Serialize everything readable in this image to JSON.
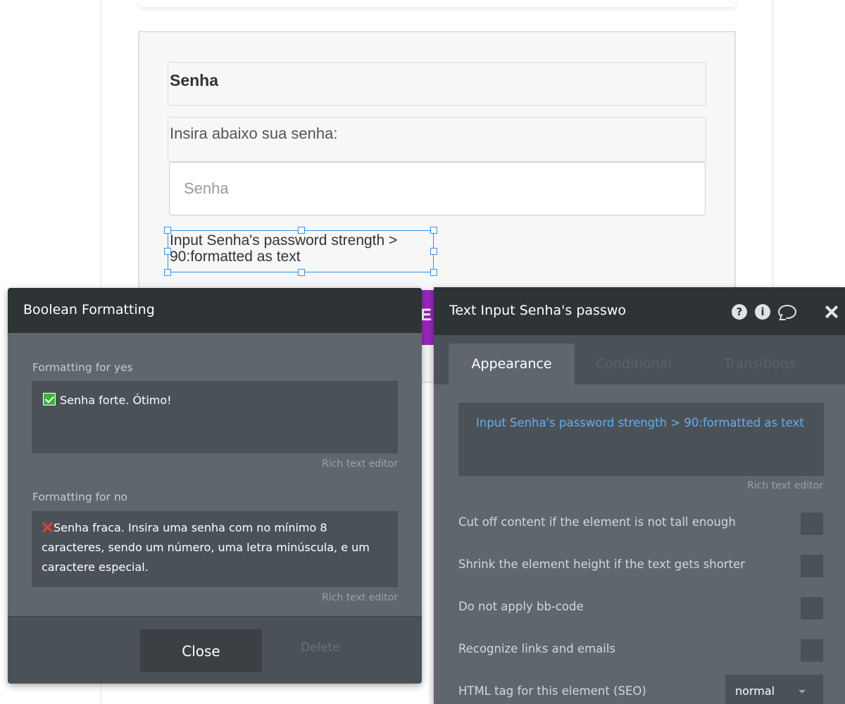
{
  "canvas": {
    "title_field": "Senha",
    "instruction": "Insira abaixo sua senha:",
    "password_placeholder": "Senha",
    "selected_text": "Input Senha's password strength > 90:formatted as text",
    "button_partial_label": "E"
  },
  "boolean_dialog": {
    "title": "Boolean Formatting",
    "yes_label": "Formatting for yes",
    "yes_text": "Senha forte. Ótimo!",
    "yes_icon": "green-check-icon",
    "no_label": "Formatting for no",
    "no_text": "Senha fraca. Insira uma senha com no mínimo 8 caracteres, sendo um número, uma letra minúscula, e um caractere especial.",
    "no_icon": "red-cross-icon",
    "rich_text_link": "Rich text editor",
    "close_label": "Close",
    "delete_label": "Delete"
  },
  "property_editor": {
    "title": "Text Input Senha's passwo",
    "icons": [
      "question-icon",
      "info-icon",
      "comment-icon",
      "close-icon"
    ],
    "tabs": [
      "Appearance",
      "Conditional",
      "Transitions"
    ],
    "active_tab": "Appearance",
    "expression": "Input Senha's password strength > 90:formatted as text",
    "rich_text_link": "Rich text editor",
    "options": [
      "Cut off content if the element is not tall enough",
      "Shrink the element height if the text gets shorter",
      "Do not apply bb-code",
      "Recognize links and emails"
    ],
    "html_tag_label": "HTML tag for this element (SEO)",
    "html_tag_value": "normal"
  },
  "colors": {
    "dialog_header": "#2e3336",
    "dialog_body": "#5f676c",
    "field_bg": "#4b5257",
    "accent_blue": "#62aef2",
    "button_purple": "#9b27c0",
    "selection_blue": "#3a8ee6"
  }
}
